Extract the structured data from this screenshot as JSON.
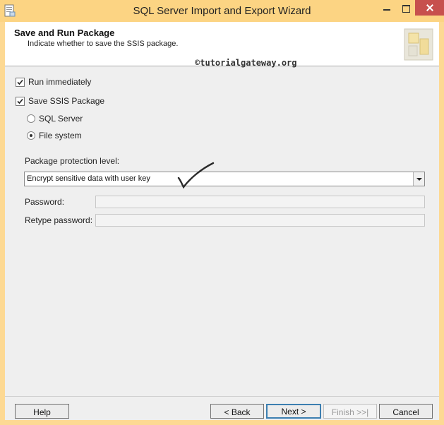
{
  "window": {
    "title": "SQL Server Import and Export Wizard"
  },
  "header": {
    "title": "Save and Run Package",
    "subtitle": "Indicate whether to save the SSIS package.",
    "watermark": "©tutorialgateway.org"
  },
  "options": {
    "run_immediately": {
      "label": "Run immediately",
      "checked": true
    },
    "save_ssis_package": {
      "label": "Save SSIS Package",
      "checked": true
    },
    "sql_server": {
      "label": "SQL Server",
      "selected": false
    },
    "file_system": {
      "label": "File system",
      "selected": true
    }
  },
  "protection": {
    "label": "Package protection level:",
    "value": "Encrypt sensitive data with user key"
  },
  "password": {
    "label": "Password:",
    "value": ""
  },
  "retype_password": {
    "label": "Retype password:",
    "value": ""
  },
  "footer": {
    "help": "Help",
    "back": "< Back",
    "next": "Next >",
    "finish": "Finish >>|",
    "cancel": "Cancel"
  },
  "colors": {
    "title_bar": "#fcd483",
    "close_button": "#c7504d",
    "dialog_background": "#efefef",
    "default_button_border": "#3c7fb1"
  }
}
